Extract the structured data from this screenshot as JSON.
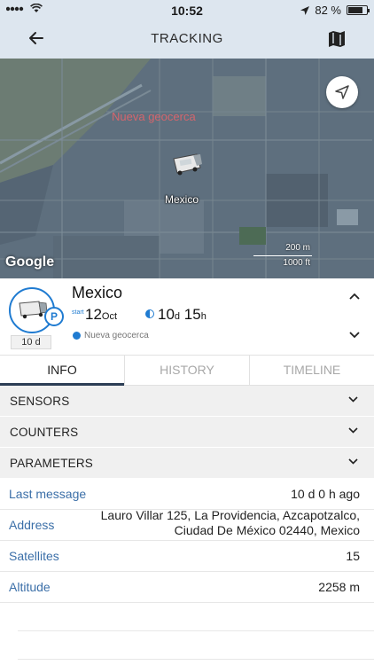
{
  "status_bar": {
    "time": "10:52",
    "battery": "82 %",
    "battery_level": 0.82
  },
  "header": {
    "title": "TRACKING",
    "back_icon": "arrow-left-icon",
    "map_icon": "map-icon"
  },
  "map": {
    "geofence_label": "Nueva geocerca",
    "unit_label": "Mexico",
    "provider": "Google",
    "scale_metric": "200 m",
    "scale_imperial": "1000 ft"
  },
  "unit": {
    "name": "Mexico",
    "badge": "10 d",
    "status_icon_text": "P",
    "start_label": "start",
    "start_day": "12",
    "start_month": "Oct",
    "duration_days": "10",
    "duration_days_unit": "d",
    "duration_hours": "15",
    "duration_hours_unit": "h",
    "geofence": "Nueva geocerca"
  },
  "tabs": [
    {
      "label": "INFO",
      "active": true
    },
    {
      "label": "HISTORY",
      "active": false
    },
    {
      "label": "TIMELINE",
      "active": false
    }
  ],
  "sections": [
    "SENSORS",
    "COUNTERS",
    "PARAMETERS"
  ],
  "details": {
    "last_message": {
      "label": "Last message",
      "value": "10 d 0 h ago"
    },
    "address": {
      "label": "Address",
      "line1": "Lauro Villar 125, La Providencia, Azcapotzalco,",
      "line2": "Ciudad De México 02440, Mexico"
    },
    "satellites": {
      "label": "Satellites",
      "value": "15"
    },
    "altitude": {
      "label": "Altitude",
      "value": "2258 m"
    }
  },
  "colors": {
    "accent": "#1f7bd1",
    "header_bg": "#dde6ef",
    "label_blue": "#3b6fa8",
    "section_bg": "#f0f0f0",
    "tab_indicator": "#2c3e55"
  }
}
